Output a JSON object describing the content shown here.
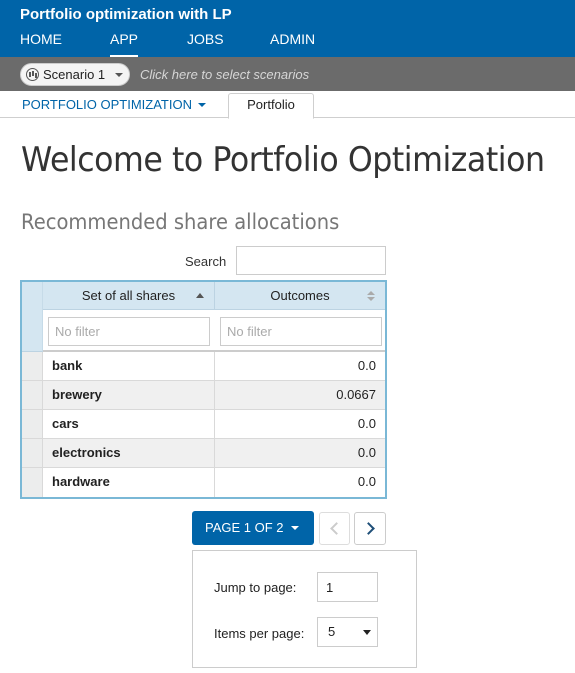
{
  "header": {
    "app_title": "Portfolio optimization with LP",
    "nav": [
      "HOME",
      "APP",
      "JOBS",
      "ADMIN"
    ],
    "active_nav": "APP"
  },
  "scenario_bar": {
    "selected": "Scenario 1",
    "hint": "Click here to select scenarios"
  },
  "tabs": {
    "dropdown_label": "PORTFOLIO OPTIMIZATION",
    "active_tab": "Portfolio"
  },
  "main": {
    "title": "Welcome to Portfolio Optimization",
    "section_title": "Recommended share allocations",
    "search_label": "Search",
    "search_value": ""
  },
  "grid": {
    "columns": [
      "Set of all shares",
      "Outcomes"
    ],
    "filter_placeholder": "No filter",
    "rows": [
      {
        "share": "bank",
        "outcome": "0.0"
      },
      {
        "share": "brewery",
        "outcome": "0.0667"
      },
      {
        "share": "cars",
        "outcome": "0.0"
      },
      {
        "share": "electronics",
        "outcome": "0.0"
      },
      {
        "share": "hardware",
        "outcome": "0.0"
      }
    ]
  },
  "pager": {
    "page_label": "PAGE 1 OF 2",
    "jump_label": "Jump to page:",
    "jump_value": "1",
    "items_label": "Items per page:",
    "items_value": "5"
  },
  "colors": {
    "brand_blue": "#0064a8",
    "scenario_bar": "#6b6b6b",
    "grid_header": "#d4e6f1",
    "grid_border": "#7ab8d6"
  }
}
